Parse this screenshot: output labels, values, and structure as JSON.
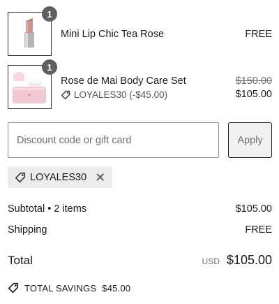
{
  "items": [
    {
      "quantity": "1",
      "name": "Mini Lip Chic Tea Rose",
      "price": "FREE",
      "thumbnail_icon": "lipstick-image"
    },
    {
      "quantity": "1",
      "name": "Rose de Mai Body Care Set",
      "original_price": "$150.00",
      "price": "$105.00",
      "discount_label": "LOYALES30 (-$45.00)",
      "thumbnail_icon": "body-care-set-image"
    }
  ],
  "discount": {
    "placeholder": "Discount code or gift card",
    "apply_label": "Apply",
    "applied_code": "LOYALES30"
  },
  "summary": {
    "subtotal_label": "Subtotal • 2 items",
    "subtotal_value": "$105.00",
    "shipping_label": "Shipping",
    "shipping_value": "FREE",
    "total_label": "Total",
    "currency": "USD",
    "total_value": "$105.00",
    "savings_label": "TOTAL SAVINGS",
    "savings_value": "$45.00"
  },
  "colors": {
    "badge": "#5f5f5f",
    "chip_bg": "#ececec",
    "text": "#1a1a1a"
  }
}
